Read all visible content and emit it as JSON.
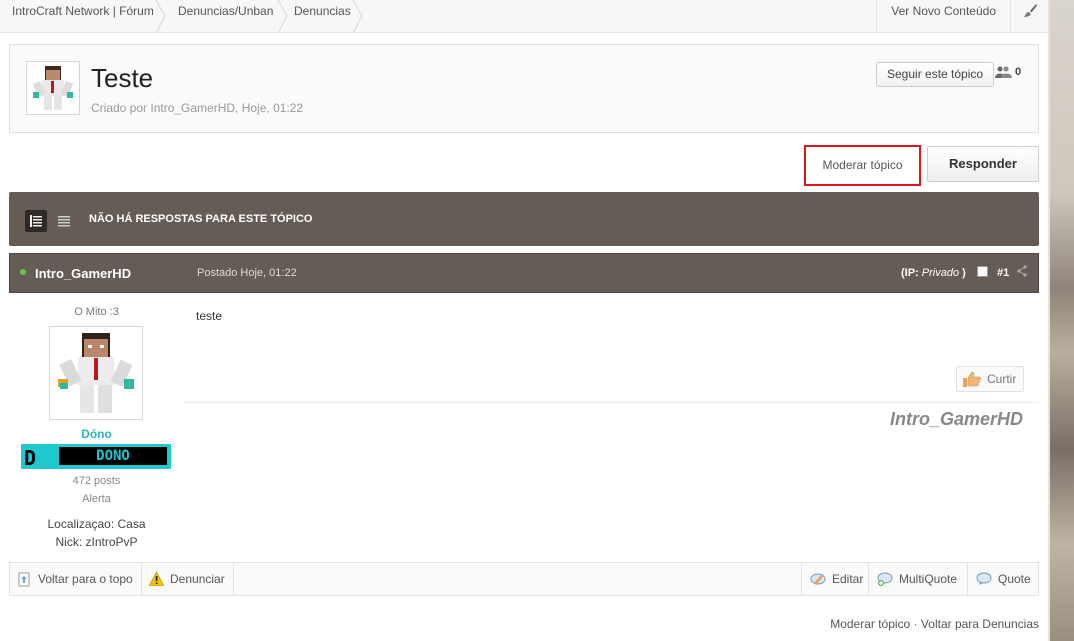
{
  "breadcrumbs": [
    "IntroCraft Network | Fórum",
    "Denuncias/Unban",
    "Denuncias"
  ],
  "header": {
    "new_content": "Ver Novo Conteúdo"
  },
  "topic": {
    "title": "Teste",
    "meta": "Criado por Intro_GamerHD, Hoje, 01:22",
    "follow_label": "Seguir este tópico",
    "followers": "0"
  },
  "actions": {
    "moderate": "Moderar tópico",
    "reply": "Responder"
  },
  "status": {
    "no_replies": "NÃO HÁ RESPOSTAS PARA ESTE TÓPICO"
  },
  "post": {
    "author": "Intro_GamerHD",
    "date": "Postado Hoje, 01:22",
    "ip_label": "(IP:",
    "ip_value": "Privado",
    "ip_close": ")",
    "number": "#1",
    "content": "teste",
    "like": "Curtir",
    "signature": "Intro_GamerHD"
  },
  "author_info": {
    "title": "O Mito :3",
    "group": "Dóno",
    "rank_letter": "D",
    "rank_text": "DONO",
    "posts": "472 posts",
    "alert": "Alerta",
    "location": "Localizaçao: Casa",
    "nick": "Nick: zIntroPvP"
  },
  "controls": {
    "back_top": "Voltar para o topo",
    "report": "Denunciar",
    "edit": "Editar",
    "multiquote": "MultiQuote",
    "quote": "Quote"
  },
  "footer": {
    "moderate": "Moderar tópico",
    "separator": "·",
    "back": "Voltar para Denuncias"
  },
  "colors": {
    "accent_red": "#e0141b",
    "bar_dark": "#645c55",
    "rank_cyan": "#1fc7cf",
    "online_green": "#6cc24a"
  }
}
